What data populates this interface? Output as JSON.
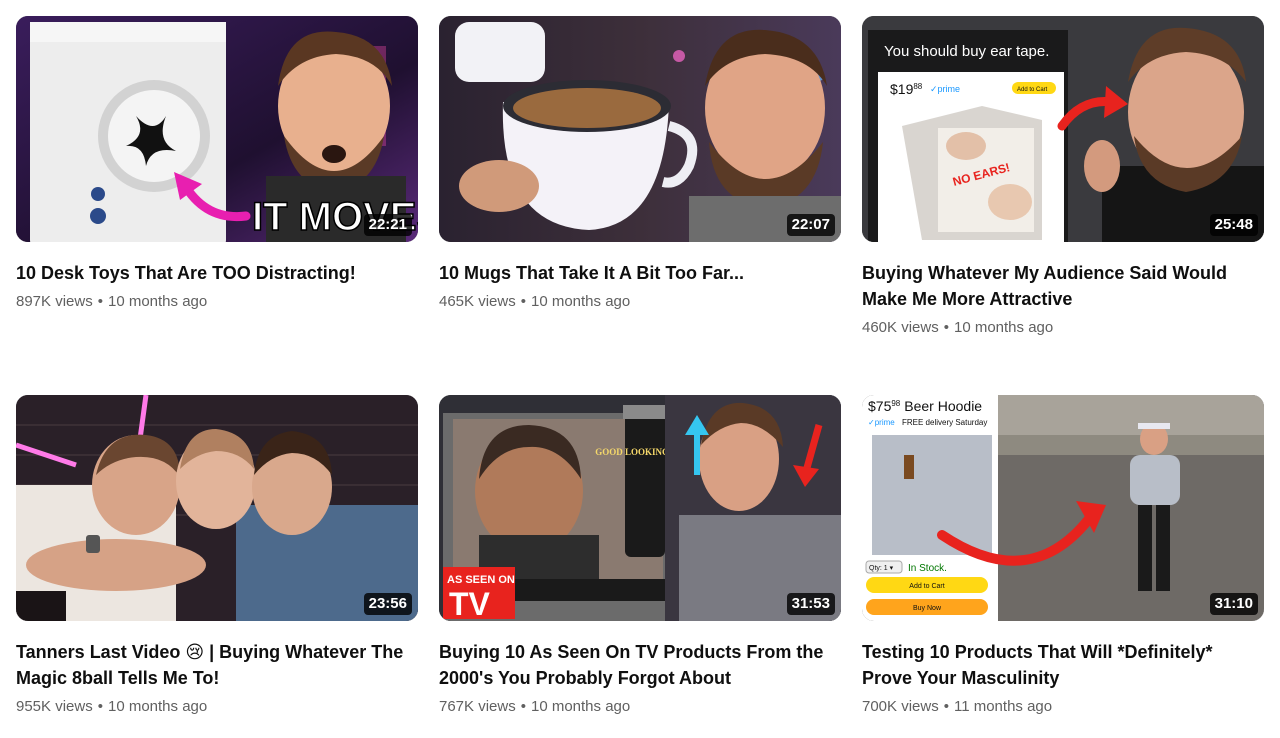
{
  "videos": [
    {
      "title": "10 Desk Toys That Are TOO Distracting!",
      "duration": "22:21",
      "views": "897K views",
      "age": "10 months ago",
      "thumb_text": "IT MOVES"
    },
    {
      "title": "10 Mugs That Take It A Bit Too Far...",
      "duration": "22:07",
      "views": "465K views",
      "age": "10 months ago"
    },
    {
      "title": "Buying Whatever My Audience Said Would Make Me More Attractive",
      "duration": "25:48",
      "views": "460K views",
      "age": "10 months ago",
      "thumb_text": "You should buy ear tape.",
      "thumb_price": "$19",
      "thumb_price_cents": "88",
      "thumb_prime": "✓prime",
      "thumb_cart": "Add to Cart",
      "thumb_box_text": "NO EARS!"
    },
    {
      "title": "Tanners Last Video 😢 | Buying Whatever The Magic 8ball Tells Me To!",
      "duration": "23:56",
      "views": "955K views",
      "age": "10 months ago"
    },
    {
      "title": "Buying 10 As Seen On TV Products From the 2000's You Probably Forgot About",
      "duration": "31:53",
      "views": "767K views",
      "age": "10 months ago",
      "thumb_badge_top": "AS SEEN ON",
      "thumb_badge_bottom": "TV",
      "thumb_can_text": "GOOD LOOKING HAIR"
    },
    {
      "title": "Testing 10 Products That Will *Definitely* Prove Your Masculinity",
      "duration": "31:10",
      "views": "700K views",
      "age": "11 months ago",
      "thumb_price": "$75",
      "thumb_price_cents": "98",
      "thumb_product": "Beer Hoodie",
      "thumb_prime": "✓prime",
      "thumb_delivery": "FREE delivery Saturday",
      "thumb_qty": "Qty: 1 ▾",
      "thumb_stock": "In Stock.",
      "thumb_cart": "Add to Cart",
      "thumb_buy": "Buy Now"
    }
  ],
  "meta_separator": "•",
  "colors": {
    "title": "#0f0f0f",
    "meta": "#606060",
    "duration_bg": "#000000",
    "amazon_yellow": "#ffd814",
    "amazon_orange": "#ffa41c",
    "arrow_red": "#e8231e",
    "arrow_pink": "#e81fb0"
  }
}
